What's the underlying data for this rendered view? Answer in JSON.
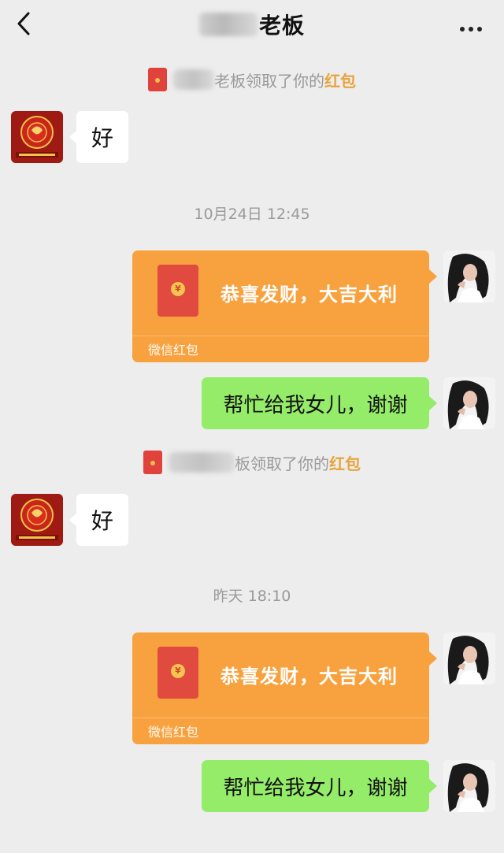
{
  "header": {
    "title": "老板",
    "back_icon": "chevron-left-icon",
    "more_icon": "more-dots-icon"
  },
  "colors": {
    "background": "#ededed",
    "red_packet": "#f8a23f",
    "outgoing_bubble": "#95ec69",
    "incoming_bubble": "#ffffff",
    "highlight": "#e8a43a"
  },
  "messages": [
    {
      "kind": "notice",
      "prefix": "老板领取了你的",
      "highlight": "红包"
    },
    {
      "kind": "incoming",
      "text": "好"
    },
    {
      "kind": "timestamp",
      "text": "10月24日 12:45"
    },
    {
      "kind": "red_packet",
      "text": "恭喜发财，大吉大利",
      "footer": "微信红包",
      "coin": "¥"
    },
    {
      "kind": "outgoing",
      "text": "帮忙给我女儿，谢谢"
    },
    {
      "kind": "notice",
      "prefix": "板领取了你的",
      "highlight": "红包"
    },
    {
      "kind": "incoming",
      "text": "好"
    },
    {
      "kind": "timestamp",
      "text": "昨天 18:10"
    },
    {
      "kind": "red_packet",
      "text": "恭喜发财，大吉大利",
      "footer": "微信红包",
      "coin": "¥"
    },
    {
      "kind": "outgoing",
      "text": "帮忙给我女儿，谢谢"
    }
  ]
}
